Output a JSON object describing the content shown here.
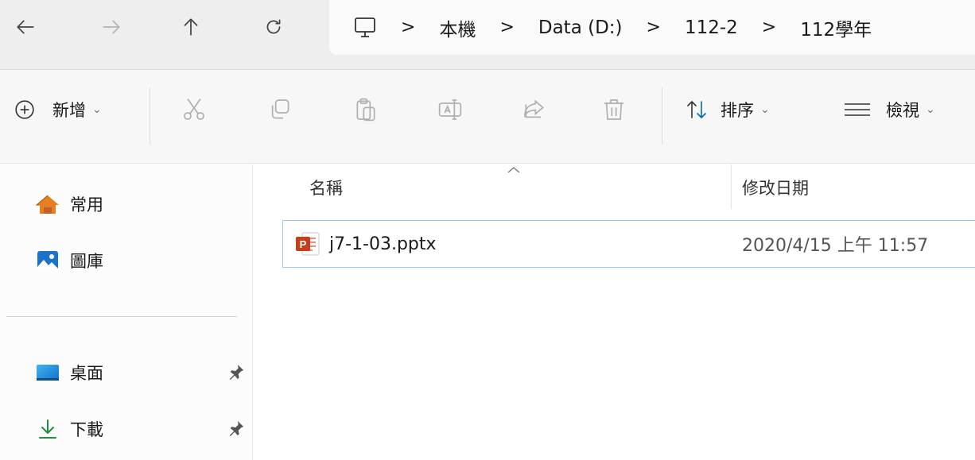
{
  "nav": {
    "back_icon": "arrow-left-icon",
    "forward_icon": "arrow-right-icon",
    "up_icon": "arrow-up-icon",
    "refresh_icon": "refresh-icon"
  },
  "breadcrumb": {
    "root_icon": "computer-icon",
    "separator": ">",
    "items": [
      "本機",
      "Data (D:)",
      "112-2",
      "112學年"
    ]
  },
  "toolbar": {
    "new_label": "新增",
    "sort_label": "排序",
    "view_label": "檢視",
    "icons": [
      "plus-circle-icon",
      "cut-icon",
      "copy-icon",
      "paste-icon",
      "rename-icon",
      "share-icon",
      "delete-icon",
      "sort-icon",
      "view-icon"
    ]
  },
  "sidebar": {
    "items": [
      {
        "label": "常用",
        "icon": "home-icon",
        "pinned": false
      },
      {
        "label": "圖庫",
        "icon": "gallery-icon",
        "pinned": false
      },
      {
        "label": "桌面",
        "icon": "desktop-icon",
        "pinned": true
      },
      {
        "label": "下載",
        "icon": "download-icon",
        "pinned": true
      }
    ]
  },
  "list": {
    "columns": [
      "名稱",
      "修改日期"
    ],
    "files": [
      {
        "name": "j7-1-03.pptx",
        "modified": "2020/4/15 上午 11:57",
        "icon": "powerpoint-file-icon"
      }
    ]
  },
  "colors": {
    "accent": "#0067c0",
    "selection_border": "#99c9ef",
    "pptx": "#c43e1c"
  }
}
